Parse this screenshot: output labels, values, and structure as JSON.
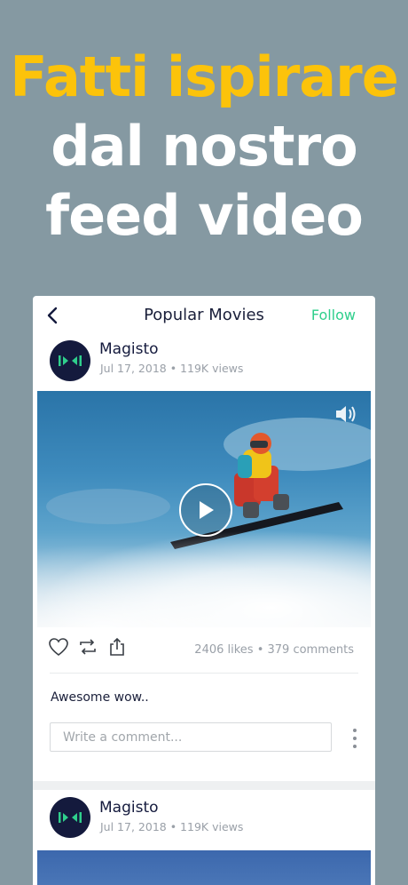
{
  "headline": {
    "line1": "Fatti ispirare",
    "line2": "dal nostro",
    "line3": "feed video",
    "accent_color": "#fcc30a"
  },
  "topbar": {
    "back_icon": "chevron-left-icon",
    "title": "Popular Movies",
    "follow_label": "Follow",
    "follow_color": "#2fcf8c"
  },
  "posts": [
    {
      "author": "Magisto",
      "meta": "Jul 17, 2018 • 119K views",
      "video_play_icon": "play-icon",
      "sound_icon": "speaker-icon",
      "stats": "2406 likes • 379 comments",
      "caption": "Awesome wow..",
      "comment_placeholder": "Write a comment..."
    },
    {
      "author": "Magisto",
      "meta": "Jul 17, 2018 • 119K views"
    }
  ]
}
